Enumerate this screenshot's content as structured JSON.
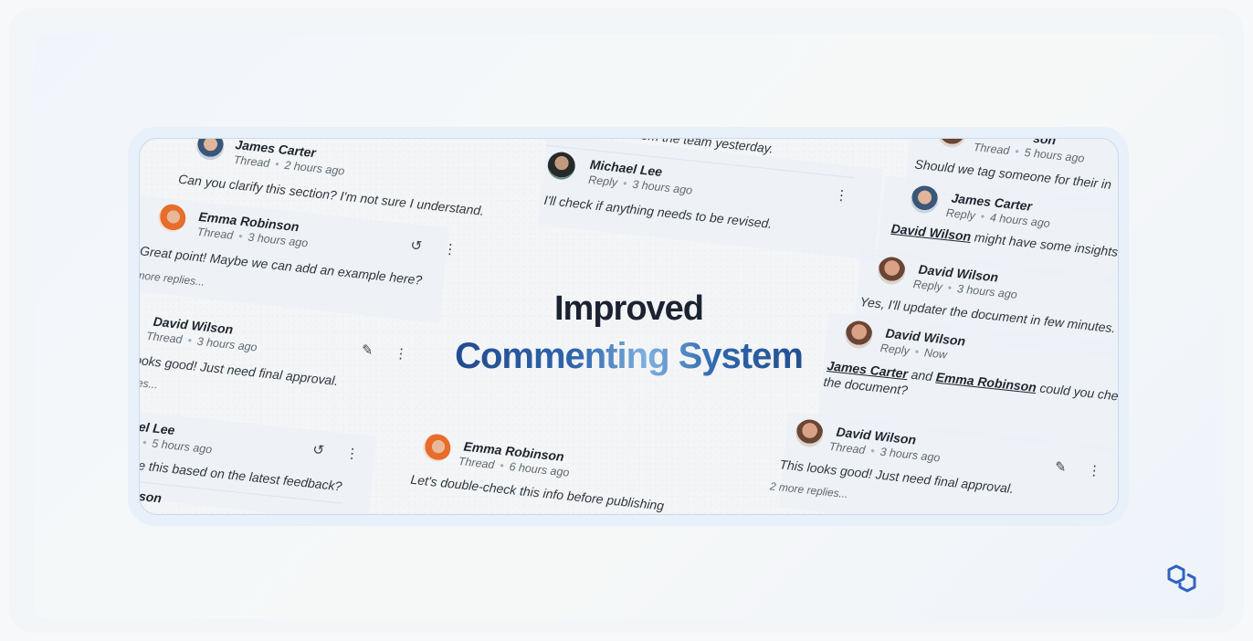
{
  "headline": {
    "line1": "Improved",
    "line2": "Commenting System"
  },
  "comments": {
    "c1": {
      "name": "James Carter",
      "type": "Thread",
      "time": "2 hours ago",
      "text": "Can you clarify this section? I'm not sure I understand."
    },
    "c2": {
      "name": "Emma Robinson",
      "type": "Thread",
      "time": "3 hours ago",
      "text": "Great point! Maybe we can add an example here?",
      "more": "more replies..."
    },
    "c3": {
      "name": "David Wilson",
      "type": "Thread",
      "time": "3 hours ago",
      "text": "ooks good! Just need final approval.",
      "more": "lies..."
    },
    "c4": {
      "name": "el Lee",
      "time": "5 hours ago",
      "text": "te this based on the latest feedback?"
    },
    "c5": {
      "name": "son"
    },
    "c6": {
      "text": "new input from the team yesterday."
    },
    "c7": {
      "name": "Michael Lee",
      "type": "Reply",
      "time": "3 hours ago",
      "text": "I'll check if anything needs to be revised."
    },
    "c8": {
      "name": "Emma Robinson",
      "type": "Thread",
      "time": "6 hours ago",
      "text": "Let's double-check this info before publishing"
    },
    "c9": {
      "name": "son",
      "type": "Thread",
      "time": "5 hours ago",
      "text": "Should we tag someone for their in"
    },
    "c10": {
      "name": "James Carter",
      "type": "Reply",
      "time": "4 hours ago",
      "mention": "David Wilson",
      "text": "might have some insights o"
    },
    "c11": {
      "name": "David Wilson",
      "type": "Reply",
      "time": "3 hours ago",
      "text": "Yes, I'll updater the document in few minutes."
    },
    "c12": {
      "name": "David Wilson",
      "type": "Reply",
      "time": "Now",
      "mention1": "James Carter",
      "and": "and",
      "mention2": "Emma Robinson",
      "text1": "could you check",
      "text2": "the document?"
    },
    "c13": {
      "name": "David Wilson",
      "type": "Thread",
      "time": "3 hours ago",
      "text": "This looks good! Just need final approval.",
      "more": "2 more replies..."
    }
  },
  "icons": [
    "undo-icon",
    "more-vertical-icon",
    "comment-check-icon",
    "logo-icon"
  ],
  "colors": {
    "headline_dark": "#1b2333",
    "headline_blue": "#2f66ad",
    "headline_light": "#7fb0e0"
  }
}
